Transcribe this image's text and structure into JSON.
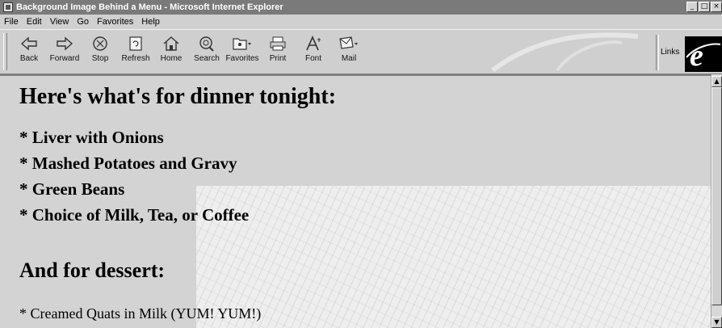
{
  "window": {
    "title": "Background Image Behind a Menu - Microsoft Internet Explorer",
    "controls": {
      "minimize": "_",
      "maximize": "□",
      "close": "×"
    }
  },
  "menubar": {
    "items": [
      {
        "label": "File"
      },
      {
        "label": "Edit"
      },
      {
        "label": "View"
      },
      {
        "label": "Go"
      },
      {
        "label": "Favorites"
      },
      {
        "label": "Help"
      }
    ]
  },
  "toolbar": {
    "buttons": [
      {
        "label": "Back",
        "icon": "back-arrow-icon"
      },
      {
        "label": "Forward",
        "icon": "forward-arrow-icon"
      },
      {
        "label": "Stop",
        "icon": "stop-icon"
      },
      {
        "label": "Refresh",
        "icon": "refresh-icon"
      },
      {
        "label": "Home",
        "icon": "home-icon"
      },
      {
        "label": "Search",
        "icon": "search-icon"
      },
      {
        "label": "Favorites",
        "icon": "favorites-icon"
      },
      {
        "label": "Print",
        "icon": "print-icon"
      },
      {
        "label": "Font",
        "icon": "font-icon"
      },
      {
        "label": "Mail",
        "icon": "mail-icon"
      }
    ],
    "links_label": "Links",
    "logo_icon": "ie-logo-icon"
  },
  "page": {
    "heading": "Here's what's for dinner tonight:",
    "menu_items": [
      "* Liver with Onions",
      "* Mashed Potatoes and Gravy",
      "* Green Beans",
      "* Choice of Milk, Tea, or Coffee"
    ],
    "dessert_heading": "And for dessert:",
    "dessert_item": "* Creamed Quats in Milk (YUM! YUM!)"
  },
  "colors": {
    "titlebar": "#7a7a7a",
    "chrome": "#c0c0c0",
    "content_bg": "#d3d3d3",
    "pattern_bg": "#eeeeee"
  }
}
